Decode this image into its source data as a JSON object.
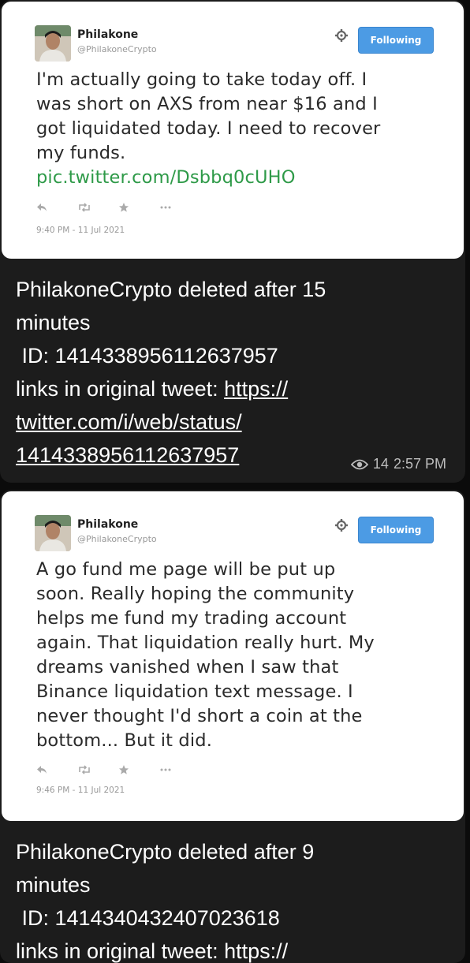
{
  "posts": [
    {
      "tweet": {
        "display_name": "Philakone",
        "handle": "@PhilakoneCrypto",
        "follow_label": "Following",
        "text_lines": [
          "I'm actually going to take today off. I",
          "was short on AXS from near $16 and I",
          "got liquidated today. I need to recover",
          "my funds."
        ],
        "pic_link": "pic.twitter.com/Dsbbq0cUHO",
        "timestamp": "9:40 PM - 11 Jul 2021"
      },
      "meta": {
        "line1": "PhilakoneCrypto deleted after 15",
        "line2": "minutes",
        "line3": " ID: 1414338956112637957",
        "line4_prefix": "links in original tweet: ",
        "line4_link": "https://",
        "line5": "twitter.com/i/web/status/",
        "line6": "1414338956112637957"
      },
      "views": "14",
      "time": "2:57 PM"
    },
    {
      "tweet": {
        "display_name": "Philakone",
        "handle": "@PhilakoneCrypto",
        "follow_label": "Following",
        "text_lines": [
          "A go fund me page will be put up",
          "soon. Really hoping the community",
          "helps me fund my trading account",
          "again. That liquidation really hurt. My",
          "dreams vanished when I saw that",
          "Binance liquidation text message. I",
          "never thought I'd short a coin at the",
          "bottom... But it did."
        ],
        "timestamp": "9:46 PM - 11 Jul 2021"
      },
      "meta": {
        "line1": "PhilakoneCrypto deleted after 9",
        "line2": "minutes",
        "line3": " ID: 1414340432407023618",
        "line4_partial": "links in original tweet: https://"
      }
    }
  ],
  "icons": {
    "reply": "reply-icon",
    "retweet": "retweet-icon",
    "favorite": "star-icon",
    "more": "more-icon",
    "settings": "gear-icon",
    "views": "eye-icon"
  },
  "colors": {
    "follow_button": "#4c9be4",
    "link_green": "#2e9a48",
    "card_dark": "#1c1c1c"
  }
}
